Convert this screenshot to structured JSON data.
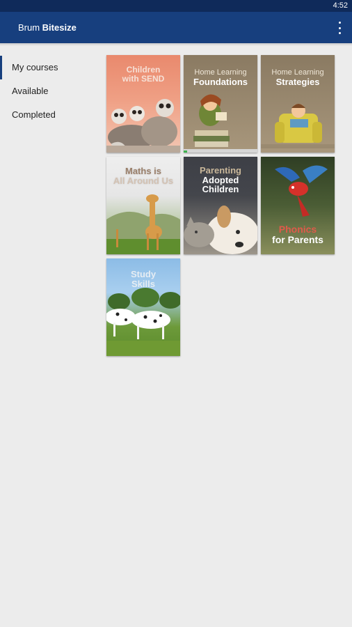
{
  "status_bar": {
    "time": "4:52"
  },
  "app_bar": {
    "title_part1": "Brum ",
    "title_part2": "Bitesize",
    "menu_icon": "more-vert-icon"
  },
  "nav": {
    "items": [
      {
        "label": "My courses",
        "active": true
      },
      {
        "label": "Available",
        "active": false
      },
      {
        "label": "Completed",
        "active": false
      }
    ]
  },
  "courses": [
    {
      "line1": "Children",
      "line2": "with SEND",
      "progress": 0
    },
    {
      "line1": "Home Learning",
      "line2": "Foundations",
      "progress": 0.05
    },
    {
      "line1": "Home Learning",
      "line2": "Strategies",
      "progress": 0
    },
    {
      "line1": "Maths is",
      "line2": "All Around Us",
      "progress": 0
    },
    {
      "line1": "Parenting",
      "line2": "Adopted",
      "line3": "Children",
      "progress": 0
    },
    {
      "line1": "Phonics",
      "line2": "for Parents",
      "progress": 0
    },
    {
      "line1": "Study",
      "line2": "Skills",
      "progress": 0
    }
  ]
}
